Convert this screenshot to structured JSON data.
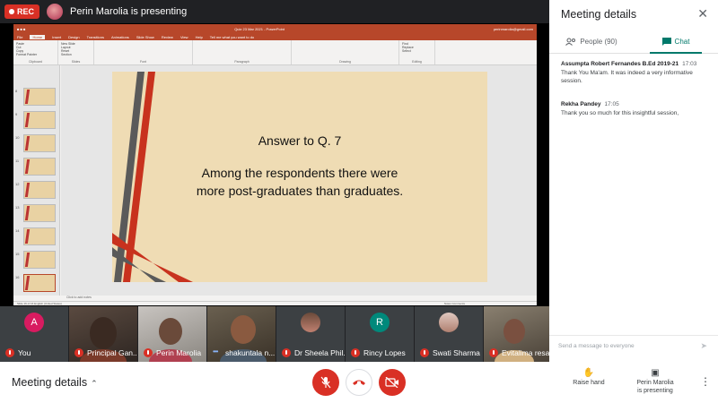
{
  "recording": {
    "label": "REC"
  },
  "presenter": {
    "text": "Perin Marolia is presenting"
  },
  "powerpoint": {
    "title": "Quiz 23 Mar 2021 - PowerPoint",
    "account": "perinmarolia@gmail.com",
    "tabs": [
      "File",
      "Home",
      "Insert",
      "Design",
      "Transitions",
      "Animations",
      "Slide Show",
      "Review",
      "View",
      "Help",
      "Tell me what you want to do"
    ],
    "active_tab": "Home",
    "ribbon_groups": [
      "Clipboard",
      "Slides",
      "Font",
      "Paragraph",
      "Drawing",
      "Editing"
    ],
    "ribbon_items": {
      "paste": "Paste",
      "cut": "Cut",
      "copy": "Copy",
      "format_painter": "Format Painter",
      "new_slide": "New Slide",
      "layout": "Layout",
      "reset": "Reset",
      "section": "Section",
      "find": "Find",
      "replace": "Replace",
      "select": "Select"
    },
    "thumbnail_numbers": [
      "8",
      "9",
      "10",
      "11",
      "12",
      "13",
      "14",
      "15",
      "16"
    ],
    "notes_placeholder": "Click to add notes",
    "status": "Slide 16 of 16    English (United States)",
    "status_right": "Notes   Comments"
  },
  "slide": {
    "line1": "Answer to Q. 7",
    "line2": "Among the respondents there were",
    "line3": "more post-graduates than graduates."
  },
  "participants": [
    {
      "name": "You",
      "initial": "A",
      "color": "#d81b60",
      "muted": true
    },
    {
      "name": "Principal Gan...",
      "muted": true
    },
    {
      "name": "Perin Marolia",
      "muted": true
    },
    {
      "name": "shakuntala n...",
      "speaking": true
    },
    {
      "name": "Dr Sheela Phil...",
      "muted": true
    },
    {
      "name": "Rincy Lopes",
      "initial": "R",
      "color": "#00897b",
      "muted": true
    },
    {
      "name": "Swati Sharma",
      "muted": true
    },
    {
      "name": "Evitalima resa",
      "muted": true
    }
  ],
  "panel": {
    "title": "Meeting details",
    "tab_people": "People (90)",
    "tab_chat": "Chat",
    "messages": [
      {
        "sender": "Assumpta Robert Fernandes B.Ed 2019-21",
        "time": "17:03",
        "text": "Thank You Ma'am. It was indeed a very informative session."
      },
      {
        "sender": "Rekha Pandey",
        "time": "17:05",
        "text": "Thank you so much for this insightful session,"
      }
    ],
    "input_placeholder": "Send a message to everyone"
  },
  "bottom": {
    "meeting_details": "Meeting details",
    "raise_hand": "Raise hand",
    "presenting_line1": "Perin Marolia",
    "presenting_line2": "is presenting"
  },
  "colors": {
    "accent": "#00796b",
    "danger": "#d93025",
    "ppt": "#b7472a"
  }
}
